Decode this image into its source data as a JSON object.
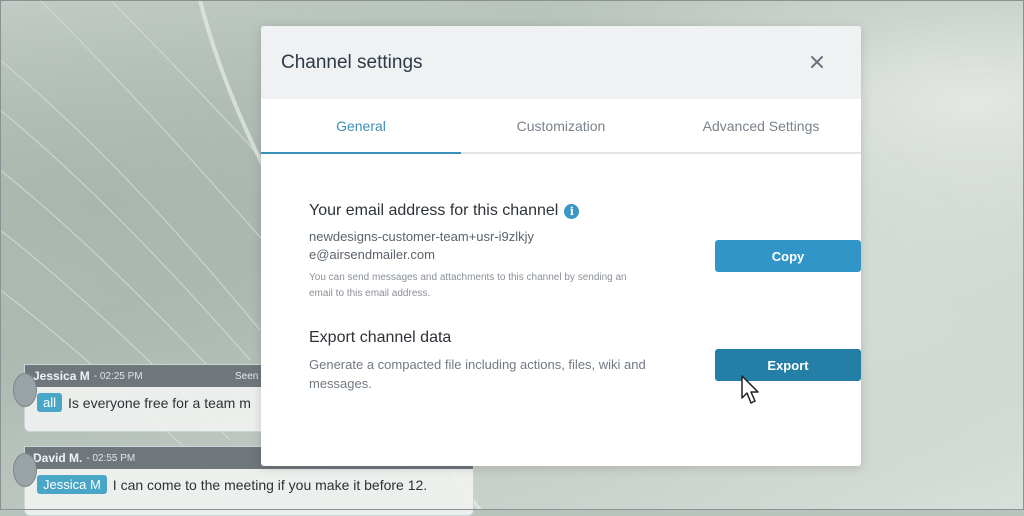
{
  "modal": {
    "title": "Channel settings",
    "close_icon": "close-icon",
    "tabs": [
      {
        "label": "General",
        "active": true
      },
      {
        "label": "Customization",
        "active": false
      },
      {
        "label": "Advanced Settings",
        "active": false
      }
    ],
    "email_section": {
      "title": "Your email address for this channel",
      "info_icon": "info-icon",
      "email": "newdesigns-customer-team+usr-i9zlkjye@airsendmailer.com",
      "hint": "You can send messages and attachments to this channel by sending an email to this email address.",
      "button_label": "Copy"
    },
    "export_section": {
      "title": "Export channel data",
      "description": "Generate a compacted file including actions, files, wiki and messages.",
      "button_label": "Export"
    }
  },
  "chat": {
    "messages": [
      {
        "author": "Jessica M",
        "time": "- 02:25 PM",
        "seen": "Seen",
        "tag": "all",
        "text": "Is everyone free for a team m"
      },
      {
        "author": "David M.",
        "time": "- 02:55 PM",
        "tag": "Jessica M",
        "text": "I can come to the meeting if you make it before 12."
      }
    ]
  },
  "colors": {
    "accent": "#3196c7",
    "active_tab": "#3a8fb7",
    "tag": "#4aa6c6"
  }
}
